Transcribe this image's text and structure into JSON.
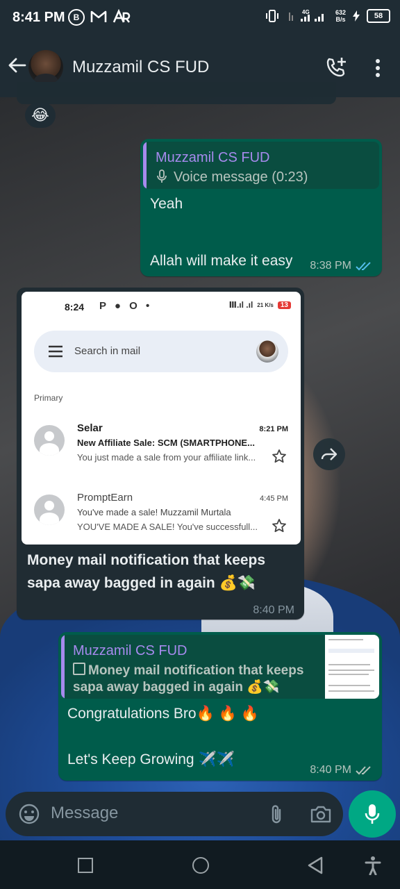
{
  "status_bar": {
    "time": "8:41 PM",
    "left_icons": [
      "b-icon",
      "gmail-icon",
      "ar-icon"
    ],
    "network": "4G",
    "speed_value": "632",
    "speed_unit": "B/s",
    "battery": "58"
  },
  "header": {
    "contact_name": "Muzzamil CS FUD"
  },
  "top_reaction": "😂",
  "messages": [
    {
      "type": "outgoing",
      "quote_name": "Muzzamil CS FUD",
      "quote_text": "Voice message (0:23)",
      "line1": "Yeah",
      "line2": "Allah will make it easy",
      "time": "8:38 PM",
      "status": "read"
    },
    {
      "type": "incoming",
      "screenshot": {
        "time": "8:24",
        "status_icons": "P ● O •",
        "signal": "Ⅲ.ıl .ıl",
        "speed": "21 K/s",
        "battery": "13",
        "search_placeholder": "Search in mail",
        "section": "Primary",
        "emails": [
          {
            "sender": "Selar",
            "time": "8:21 PM",
            "subject": "New Affiliate Sale: SCM (SMARTPHONE...",
            "preview": "You just made a sale from your affiliate link...",
            "unread": true
          },
          {
            "sender": "PromptEarn",
            "time": "4:45 PM",
            "subject": "You've made a sale! Muzzamil Murtala",
            "preview": "YOU'VE MADE A SALE! You've successfull...",
            "unread": false
          }
        ]
      },
      "caption": "Money mail notification that keeps sapa away bagged in again 💰💸",
      "time": "8:40 PM"
    },
    {
      "type": "outgoing",
      "quote_name": "Muzzamil CS FUD",
      "quote_text": "Money mail notification that keeps sapa away bagged in again 💰💸",
      "line1": "Congratulations Bro🔥 🔥 🔥",
      "line2": "Let's Keep Growing ✈️✈️",
      "time": "8:40 PM",
      "status": "delivered"
    }
  ],
  "input": {
    "placeholder": "Message"
  },
  "colors": {
    "header_bg": "#1f2c34",
    "outgoing_bubble": "#005c4b",
    "incoming_bubble": "#202c33",
    "quote_accent": "#a68aed",
    "read_tick": "#53bdeb",
    "mic_button": "#00a884"
  }
}
